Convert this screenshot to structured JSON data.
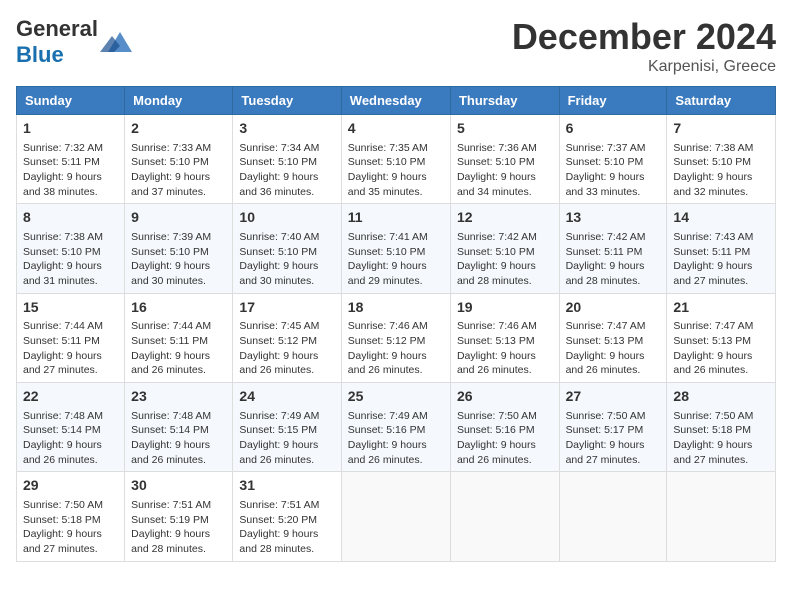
{
  "header": {
    "logo_line1": "General",
    "logo_line2": "Blue",
    "month": "December 2024",
    "location": "Karpenisi, Greece"
  },
  "weekdays": [
    "Sunday",
    "Monday",
    "Tuesday",
    "Wednesday",
    "Thursday",
    "Friday",
    "Saturday"
  ],
  "weeks": [
    [
      {
        "day": "1",
        "info": "Sunrise: 7:32 AM\nSunset: 5:11 PM\nDaylight: 9 hours\nand 38 minutes."
      },
      {
        "day": "2",
        "info": "Sunrise: 7:33 AM\nSunset: 5:10 PM\nDaylight: 9 hours\nand 37 minutes."
      },
      {
        "day": "3",
        "info": "Sunrise: 7:34 AM\nSunset: 5:10 PM\nDaylight: 9 hours\nand 36 minutes."
      },
      {
        "day": "4",
        "info": "Sunrise: 7:35 AM\nSunset: 5:10 PM\nDaylight: 9 hours\nand 35 minutes."
      },
      {
        "day": "5",
        "info": "Sunrise: 7:36 AM\nSunset: 5:10 PM\nDaylight: 9 hours\nand 34 minutes."
      },
      {
        "day": "6",
        "info": "Sunrise: 7:37 AM\nSunset: 5:10 PM\nDaylight: 9 hours\nand 33 minutes."
      },
      {
        "day": "7",
        "info": "Sunrise: 7:38 AM\nSunset: 5:10 PM\nDaylight: 9 hours\nand 32 minutes."
      }
    ],
    [
      {
        "day": "8",
        "info": "Sunrise: 7:38 AM\nSunset: 5:10 PM\nDaylight: 9 hours\nand 31 minutes."
      },
      {
        "day": "9",
        "info": "Sunrise: 7:39 AM\nSunset: 5:10 PM\nDaylight: 9 hours\nand 30 minutes."
      },
      {
        "day": "10",
        "info": "Sunrise: 7:40 AM\nSunset: 5:10 PM\nDaylight: 9 hours\nand 30 minutes."
      },
      {
        "day": "11",
        "info": "Sunrise: 7:41 AM\nSunset: 5:10 PM\nDaylight: 9 hours\nand 29 minutes."
      },
      {
        "day": "12",
        "info": "Sunrise: 7:42 AM\nSunset: 5:10 PM\nDaylight: 9 hours\nand 28 minutes."
      },
      {
        "day": "13",
        "info": "Sunrise: 7:42 AM\nSunset: 5:11 PM\nDaylight: 9 hours\nand 28 minutes."
      },
      {
        "day": "14",
        "info": "Sunrise: 7:43 AM\nSunset: 5:11 PM\nDaylight: 9 hours\nand 27 minutes."
      }
    ],
    [
      {
        "day": "15",
        "info": "Sunrise: 7:44 AM\nSunset: 5:11 PM\nDaylight: 9 hours\nand 27 minutes."
      },
      {
        "day": "16",
        "info": "Sunrise: 7:44 AM\nSunset: 5:11 PM\nDaylight: 9 hours\nand 26 minutes."
      },
      {
        "day": "17",
        "info": "Sunrise: 7:45 AM\nSunset: 5:12 PM\nDaylight: 9 hours\nand 26 minutes."
      },
      {
        "day": "18",
        "info": "Sunrise: 7:46 AM\nSunset: 5:12 PM\nDaylight: 9 hours\nand 26 minutes."
      },
      {
        "day": "19",
        "info": "Sunrise: 7:46 AM\nSunset: 5:13 PM\nDaylight: 9 hours\nand 26 minutes."
      },
      {
        "day": "20",
        "info": "Sunrise: 7:47 AM\nSunset: 5:13 PM\nDaylight: 9 hours\nand 26 minutes."
      },
      {
        "day": "21",
        "info": "Sunrise: 7:47 AM\nSunset: 5:13 PM\nDaylight: 9 hours\nand 26 minutes."
      }
    ],
    [
      {
        "day": "22",
        "info": "Sunrise: 7:48 AM\nSunset: 5:14 PM\nDaylight: 9 hours\nand 26 minutes."
      },
      {
        "day": "23",
        "info": "Sunrise: 7:48 AM\nSunset: 5:14 PM\nDaylight: 9 hours\nand 26 minutes."
      },
      {
        "day": "24",
        "info": "Sunrise: 7:49 AM\nSunset: 5:15 PM\nDaylight: 9 hours\nand 26 minutes."
      },
      {
        "day": "25",
        "info": "Sunrise: 7:49 AM\nSunset: 5:16 PM\nDaylight: 9 hours\nand 26 minutes."
      },
      {
        "day": "26",
        "info": "Sunrise: 7:50 AM\nSunset: 5:16 PM\nDaylight: 9 hours\nand 26 minutes."
      },
      {
        "day": "27",
        "info": "Sunrise: 7:50 AM\nSunset: 5:17 PM\nDaylight: 9 hours\nand 27 minutes."
      },
      {
        "day": "28",
        "info": "Sunrise: 7:50 AM\nSunset: 5:18 PM\nDaylight: 9 hours\nand 27 minutes."
      }
    ],
    [
      {
        "day": "29",
        "info": "Sunrise: 7:50 AM\nSunset: 5:18 PM\nDaylight: 9 hours\nand 27 minutes."
      },
      {
        "day": "30",
        "info": "Sunrise: 7:51 AM\nSunset: 5:19 PM\nDaylight: 9 hours\nand 28 minutes."
      },
      {
        "day": "31",
        "info": "Sunrise: 7:51 AM\nSunset: 5:20 PM\nDaylight: 9 hours\nand 28 minutes."
      },
      null,
      null,
      null,
      null
    ]
  ]
}
